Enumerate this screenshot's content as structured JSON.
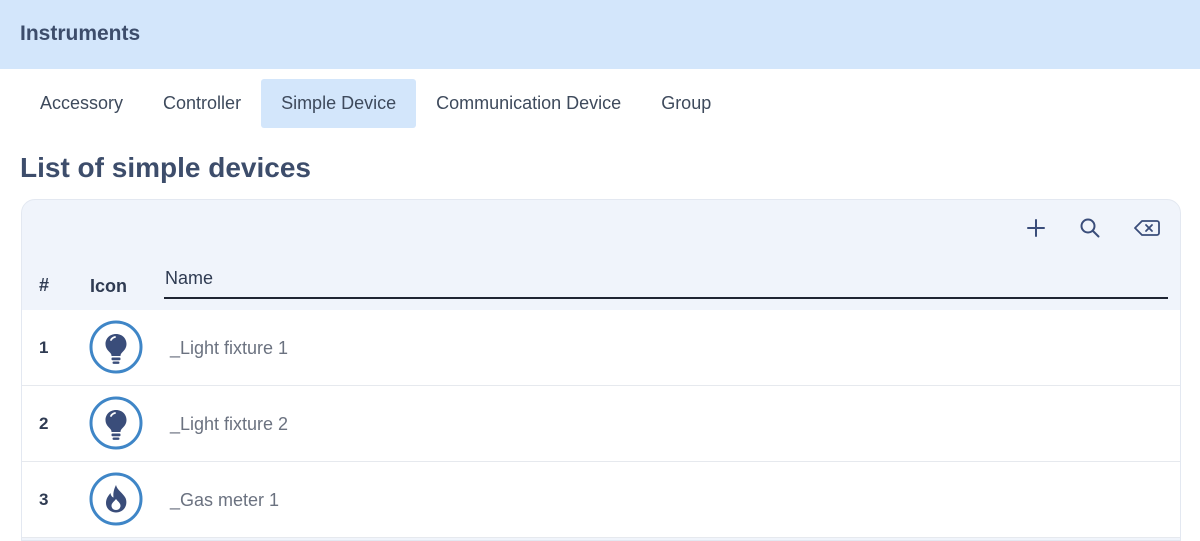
{
  "header": {
    "title": "Instruments"
  },
  "tabs": [
    {
      "label": "Accessory",
      "active": false
    },
    {
      "label": "Controller",
      "active": false
    },
    {
      "label": "Simple Device",
      "active": true
    },
    {
      "label": "Communication Device",
      "active": false
    },
    {
      "label": "Group",
      "active": false
    }
  ],
  "page_title": "List of simple devices",
  "toolbar": {
    "add_icon": "plus-icon",
    "search_icon": "search-icon",
    "clear_icon": "clear-filter-icon"
  },
  "table": {
    "columns": {
      "num": "#",
      "icon": "Icon",
      "name": "Name"
    },
    "rows": [
      {
        "num": "1",
        "icon": "light-bulb-icon",
        "name": "_Light fixture 1"
      },
      {
        "num": "2",
        "icon": "light-bulb-icon",
        "name": "_Light fixture 2"
      },
      {
        "num": "3",
        "icon": "flame-icon",
        "name": "_Gas meter 1"
      }
    ]
  },
  "colors": {
    "header_bg": "#d3e6fb",
    "title_text": "#3d4d6b",
    "icon_ring": "#3f86c7",
    "icon_fill": "#3a4d7a"
  }
}
